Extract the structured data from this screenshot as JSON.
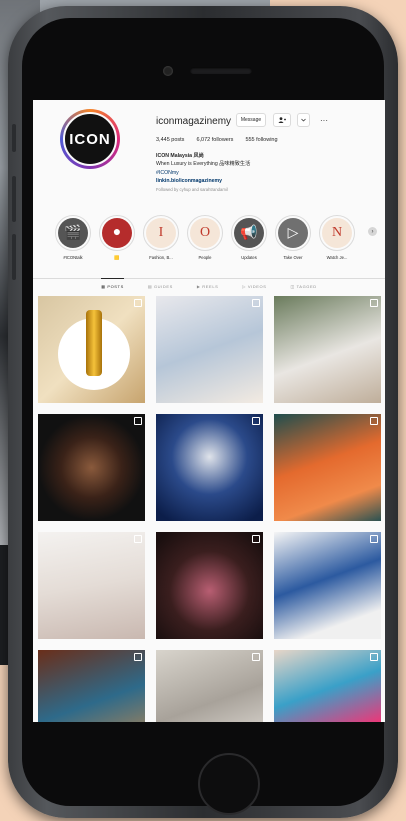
{
  "profile": {
    "username": "iconmagazinemy",
    "avatar_text": "ICON",
    "message_label": "Message",
    "posts": "3,445 posts",
    "followers": "6,072 followers",
    "following": "555 following",
    "display_name": "ICON Malaysia 风尚",
    "bio_line": "When Luxury is Everything 品味精致生活",
    "hashtag": "#ICONmy",
    "link": "linkin.bio/iconmagazinemy",
    "followed_by": "Followed by cyhup and sarahtrandamil"
  },
  "highlights": [
    {
      "label": "#ICONtalk",
      "glyph": "🎬",
      "bg": "#555555",
      "fg": "#ffffff"
    },
    {
      "label": "🟨",
      "glyph": "●",
      "bg": "#b52c2c",
      "fg": "#ffffff"
    },
    {
      "label": "Fashion, B...",
      "glyph": "I",
      "bg": "#f5e6d8",
      "fg": "#c0392b"
    },
    {
      "label": "People",
      "glyph": "O",
      "bg": "#f5e6d8",
      "fg": "#c0392b"
    },
    {
      "label": "Updates",
      "glyph": "📢",
      "bg": "#555555",
      "fg": "#ffffff"
    },
    {
      "label": "Take Over",
      "glyph": "▷",
      "bg": "#707070",
      "fg": "#ffffff"
    },
    {
      "label": "Watch Je...",
      "glyph": "N",
      "bg": "#f5e6d8",
      "fg": "#c0392b"
    }
  ],
  "tabs": [
    "POSTS",
    "GUIDES",
    "REELS",
    "VIDEOS",
    "TAGGED"
  ],
  "posts": [
    {
      "name": "post-icon-picks",
      "bg": "linear-gradient(135deg,#d8c6a2,#f0e0c0 50%,#c7a46e)"
    },
    {
      "name": "post-exhibition",
      "bg": "linear-gradient(160deg,#e8e8ec,#b6c6d8 50%,#f3ebe2)"
    },
    {
      "name": "post-wedding",
      "bg": "linear-gradient(160deg,#6a7b5c,#e9e6e2 55%,#bfae9a)"
    },
    {
      "name": "post-watch",
      "bg": "radial-gradient(circle at 50% 50%,#8a5a3c 0,#3a2218 40%,#111 70%)"
    },
    {
      "name": "post-model",
      "bg": "radial-gradient(circle at 50% 40%,#dfe3ea 0,#2b4a8a 45%,#0c1e4a 90%)"
    },
    {
      "name": "post-orange-bag",
      "bg": "linear-gradient(160deg,#1f4e4e,#e46a2e 45%,#f08a4a 75%,#2a5252)"
    },
    {
      "name": "post-red-carpet",
      "bg": "linear-gradient(170deg,#f4f2f0,#e4dcd6 50%,#c9b8b0)"
    },
    {
      "name": "post-necklace",
      "bg": "radial-gradient(circle at 50% 55%,#b85e72 0,#3a1e1e 50%,#1a0f0f 90%)"
    },
    {
      "name": "post-sandals",
      "bg": "linear-gradient(160deg,#f5f5f5,#2c5aa0 45%,#f0f0f0 80%)"
    },
    {
      "name": "post-party",
      "bg": "linear-gradient(160deg,#6a2e1a,#2e6a8a 50%,#c98a4a)"
    },
    {
      "name": "post-luggage",
      "bg": "linear-gradient(160deg,#d8d4cc,#a8a29a 50%,#eae6e0)"
    },
    {
      "name": "post-colorful",
      "bg": "linear-gradient(160deg,#e8d6c8,#3aa0c8 40%,#e83a7a 75%,#f0c040)"
    }
  ]
}
